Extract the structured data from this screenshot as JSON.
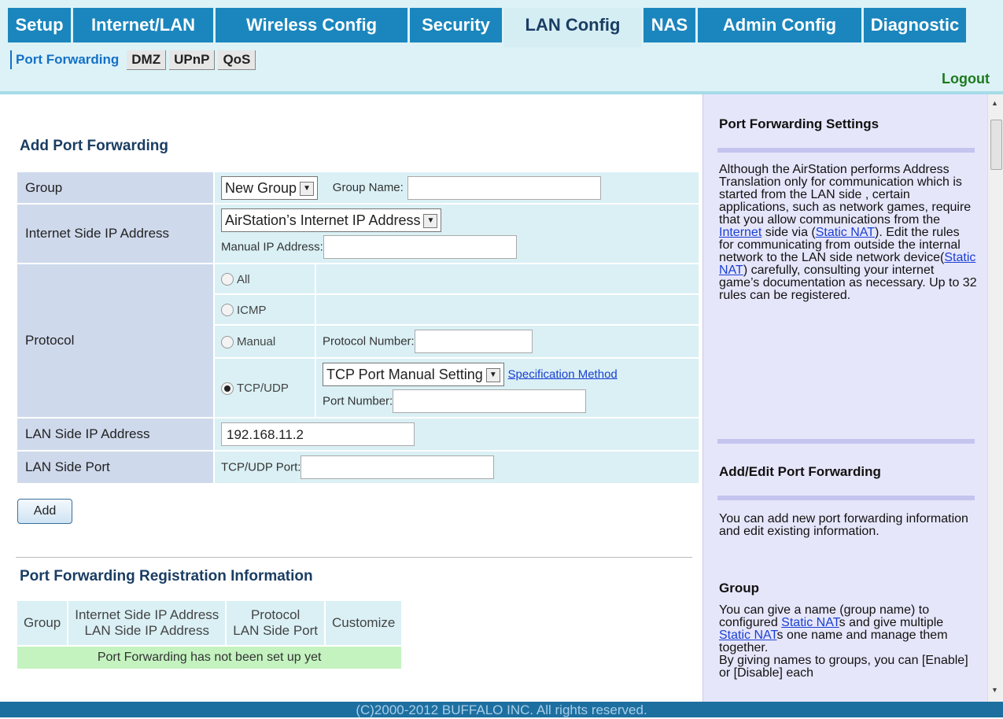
{
  "nav": {
    "tabs": [
      "Setup",
      "Internet/LAN",
      "Wireless Config",
      "Security",
      "LAN Config",
      "NAS",
      "Admin Config",
      "Diagnostic"
    ],
    "active_tab": "LAN Config",
    "subtabs": [
      "Port Forwarding",
      "DMZ",
      "UPnP",
      "QoS"
    ],
    "active_subtab": "Port Forwarding",
    "logout": "Logout"
  },
  "form": {
    "title": "Add Port Forwarding",
    "group_label": "Group",
    "group_select": "New Group",
    "group_name_label": "Group Name:",
    "group_name_value": "",
    "internet_ip_label": "Internet Side IP Address",
    "internet_ip_select": "AirStation’s Internet IP Address",
    "manual_ip_label": "Manual IP Address:",
    "manual_ip_value": "",
    "protocol_label": "Protocol",
    "protocol_options": [
      "All",
      "ICMP",
      "Manual",
      "TCP/UDP"
    ],
    "protocol_selected": "TCP/UDP",
    "protocol_number_label": "Protocol Number:",
    "protocol_number_value": "",
    "port_setting_select": "TCP Port Manual Setting",
    "spec_method_link": "Specification Method",
    "port_number_label": "Port Number:",
    "port_number_value": "",
    "lan_ip_label": "LAN Side IP Address",
    "lan_ip_value": "192.168.11.2",
    "lan_port_label": "LAN Side Port",
    "tcp_udp_port_label": "TCP/UDP Port:",
    "tcp_udp_port_value": "",
    "add_button": "Add"
  },
  "registration": {
    "title": "Port Forwarding Registration Information",
    "col_group": "Group",
    "col_ip_line1": "Internet Side IP Address",
    "col_ip_line2": "LAN Side IP Address",
    "col_proto_line1": "Protocol",
    "col_proto_line2": "LAN Side Port",
    "col_customize": "Customize",
    "empty_message": "Port Forwarding has not been set up yet"
  },
  "help": {
    "h1": "Port Forwarding Settings",
    "p1_a": "Although the AirStation performs Address Translation only for communication which is started from the LAN side , certain applications, such as network games, require that you allow communications from the ",
    "p1_link1": "Internet",
    "p1_b": " side via (",
    "p1_link2": "Static NAT",
    "p1_c": "). Edit the rules for communicating from outside the internal network to the LAN side network device(",
    "p1_link3": "Static NAT",
    "p1_d": ") carefully, consulting your internet game’s documentation as necessary. Up to 32 rules can be registered.",
    "h2": "Add/Edit Port Forwarding",
    "p2": "You can add new port forwarding information and edit existing information.",
    "h3": "Group",
    "p3_a": "You can give a name (group name) to configured ",
    "p3_link1": "Static NAT",
    "p3_b": "s and give multiple ",
    "p3_link2": "Static NAT",
    "p3_c": "s one name and manage them together.",
    "p3_d": "By giving names to groups, you can [Enable] or [Disable] each"
  },
  "footer": "(C)2000-2012 BUFFALO INC. All rights reserved."
}
